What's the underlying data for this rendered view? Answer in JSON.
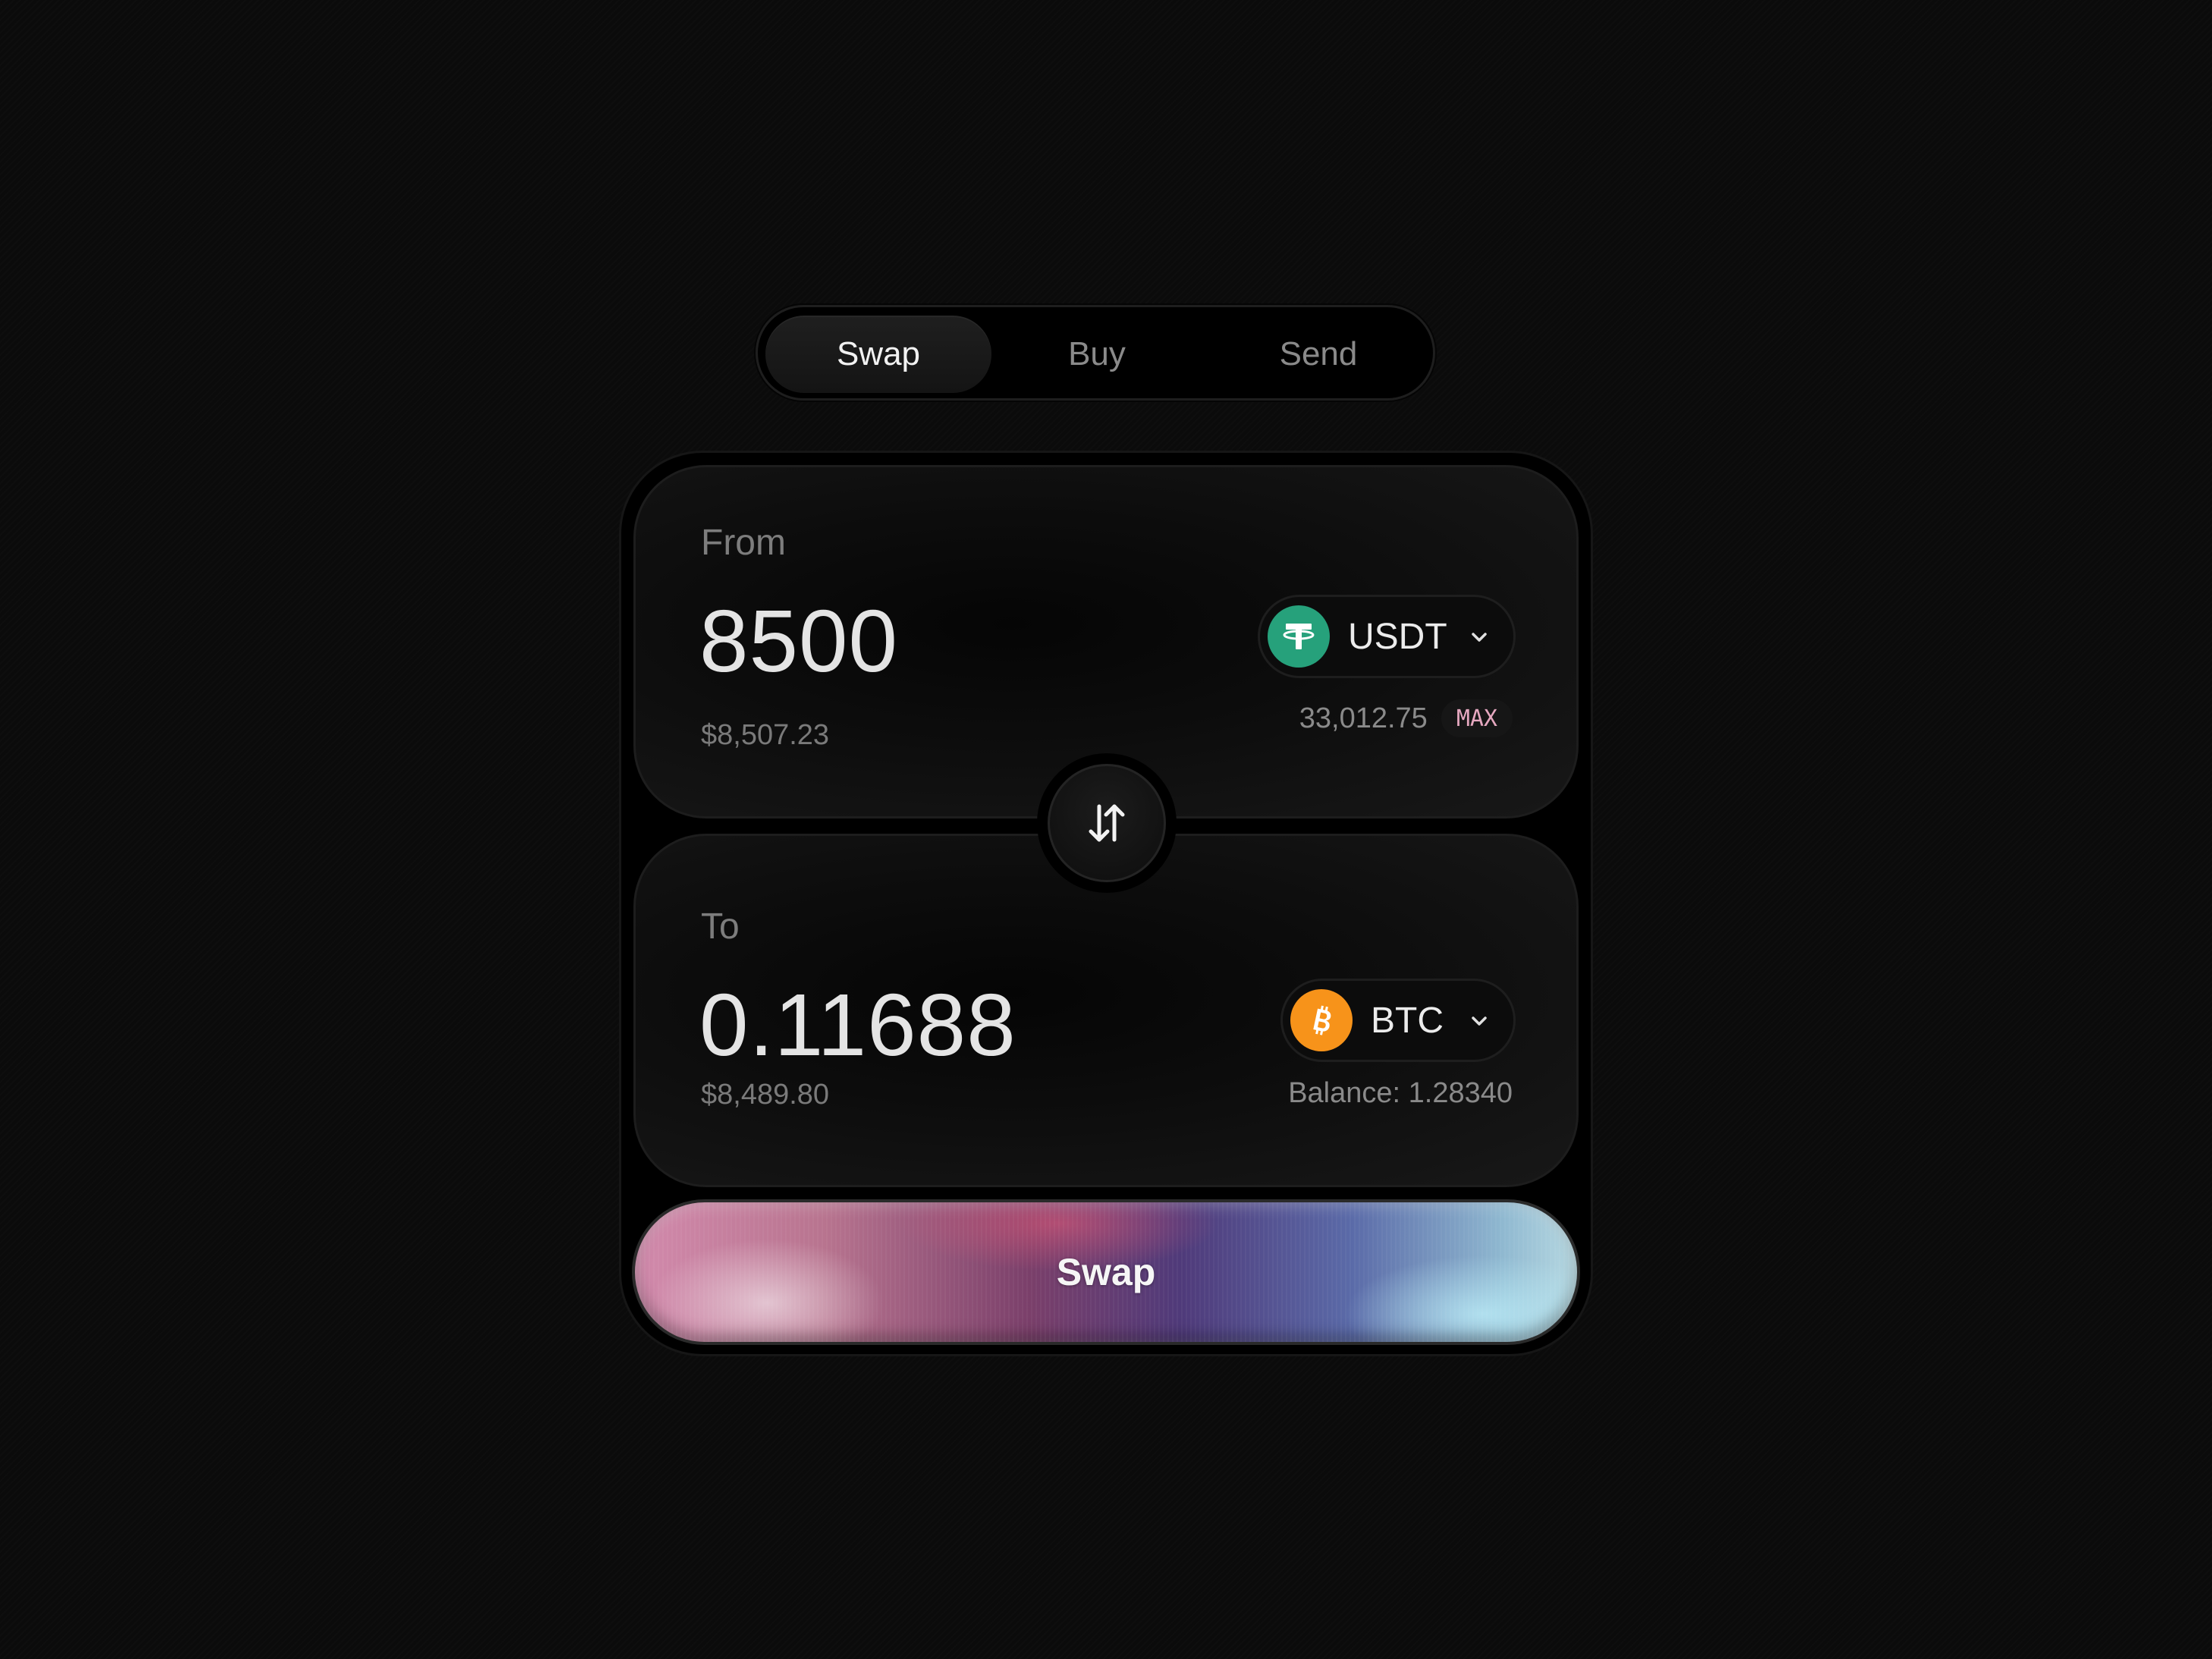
{
  "tabs": [
    {
      "label": "Swap",
      "active": true
    },
    {
      "label": "Buy",
      "active": false
    },
    {
      "label": "Send",
      "active": false
    }
  ],
  "from": {
    "label": "From",
    "amount": "8500",
    "usd_value": "$8,507.23",
    "token": {
      "symbol": "USDT",
      "icon": "tether-icon",
      "color": "#26a17b"
    },
    "balance": "33,012.75",
    "max_label": "MAX"
  },
  "to": {
    "label": "To",
    "amount": "0.11688",
    "usd_value": "$8,489.80",
    "token": {
      "symbol": "BTC",
      "icon": "bitcoin-icon",
      "color": "#f7931a"
    },
    "balance": "Balance: 1.28340"
  },
  "switch_icon": "swap-arrows-icon",
  "swap_button": {
    "label": "Swap"
  }
}
